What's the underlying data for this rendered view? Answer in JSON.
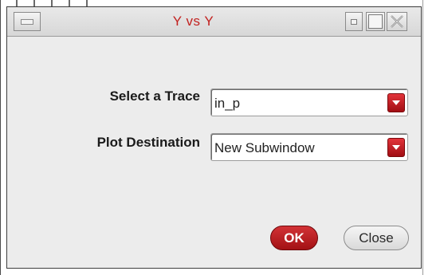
{
  "window": {
    "title": "Y vs Y",
    "title_color": "#c2211f",
    "controls": [
      "menu-icon",
      "minimize-icon",
      "maximize-icon",
      "close-icon"
    ]
  },
  "form": {
    "trace_label": "Select a Trace",
    "trace_value": "in_p",
    "destination_label": "Plot Destination",
    "destination_value": "New Subwindow"
  },
  "buttons": {
    "ok_label": "OK",
    "close_label": "Close"
  },
  "colors": {
    "accent": "#b8181c",
    "dialog_bg": "#ececec"
  }
}
